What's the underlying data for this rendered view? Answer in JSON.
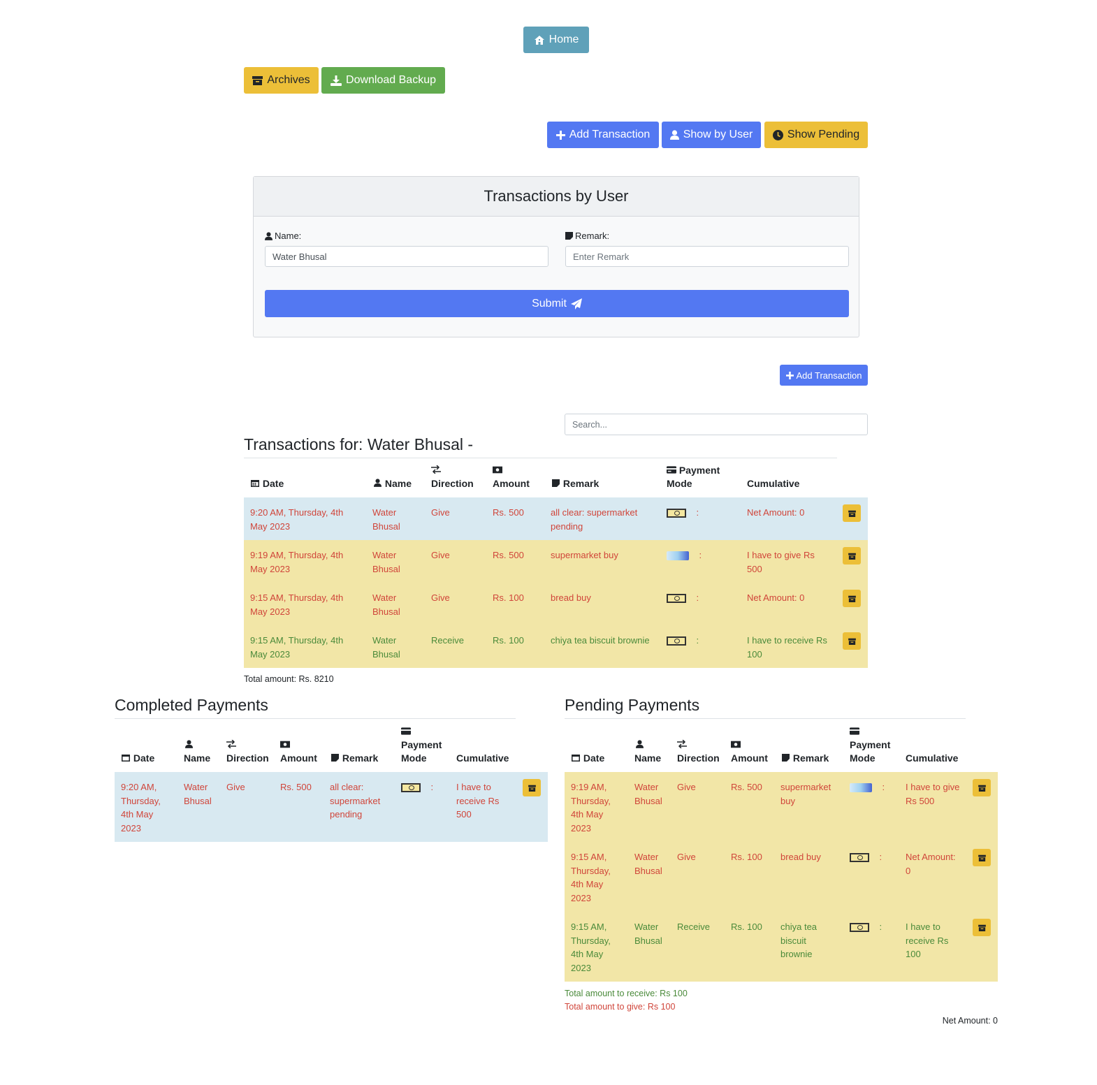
{
  "nav": {
    "home": "Home",
    "archives": "Archives",
    "download_backup": "Download Backup"
  },
  "toolbar": {
    "add_transaction": "Add Transaction",
    "show_by_user": "Show by User",
    "show_pending": "Show Pending"
  },
  "form": {
    "title": "Transactions by User",
    "name_label": "Name:",
    "name_value": "Water Bhusal",
    "remark_label": "Remark:",
    "remark_placeholder": "Enter Remark",
    "submit": "Submit"
  },
  "add_transaction_small": "Add Transaction",
  "search_placeholder": "Search...",
  "main_table": {
    "title": "Transactions for: Water Bhusal -",
    "headers": {
      "date": "Date",
      "name": "Name",
      "direction": "Direction",
      "amount": "Amount",
      "remark": "Remark",
      "payment_mode": "Payment Mode",
      "cumulative": "Cumulative"
    },
    "rows": [
      {
        "date": "9:20 AM, Thursday, 4th May 2023",
        "name": "Water Bhusal",
        "direction": "Give",
        "amount": "Rs. 500",
        "remark": "all clear: supermarket pending",
        "mode_icon": "cash-icon",
        "mode_sep": ":",
        "cumulative": "Net Amount: 0"
      },
      {
        "date": "9:19 AM, Thursday, 4th May 2023",
        "name": "Water Bhusal",
        "direction": "Give",
        "amount": "Rs. 500",
        "remark": "supermarket buy",
        "mode_icon": "card-icon",
        "mode_sep": ":",
        "cumulative": "I have to give Rs 500"
      },
      {
        "date": "9:15 AM, Thursday, 4th May 2023",
        "name": "Water Bhusal",
        "direction": "Give",
        "amount": "Rs. 100",
        "remark": "bread buy",
        "mode_icon": "cash-icon",
        "mode_sep": ":",
        "cumulative": "Net Amount: 0"
      },
      {
        "date": "9:15 AM, Thursday, 4th May 2023",
        "name": "Water Bhusal",
        "direction": "Receive",
        "amount": "Rs. 100",
        "remark": "chiya tea biscuit brownie",
        "mode_icon": "cash-icon",
        "mode_sep": ":",
        "cumulative": "I have to receive Rs 100"
      }
    ],
    "total": "Total amount: Rs. 8210"
  },
  "completed": {
    "title": "Completed Payments",
    "rows": [
      {
        "date": "9:20 AM, Thursday, 4th May 2023",
        "name": "Water Bhusal",
        "direction": "Give",
        "amount": "Rs. 500",
        "remark": "all clear: supermarket pending",
        "mode_icon": "cash-icon",
        "mode_sep": ":",
        "cumulative": "I have to receive Rs 500"
      }
    ]
  },
  "pending": {
    "title": "Pending Payments",
    "rows": [
      {
        "date": "9:19 AM, Thursday, 4th May 2023",
        "name": "Water Bhusal",
        "direction": "Give",
        "amount": "Rs. 500",
        "remark": "supermarket buy",
        "mode_icon": "card-icon",
        "mode_sep": ":",
        "cumulative": "I have to give Rs 500"
      },
      {
        "date": "9:15 AM, Thursday, 4th May 2023",
        "name": "Water Bhusal",
        "direction": "Give",
        "amount": "Rs. 100",
        "remark": "bread buy",
        "mode_icon": "cash-icon",
        "mode_sep": ":",
        "cumulative": "Net Amount: 0"
      },
      {
        "date": "9:15 AM, Thursday, 4th May 2023",
        "name": "Water Bhusal",
        "direction": "Receive",
        "amount": "Rs. 100",
        "remark": "chiya tea biscuit brownie",
        "mode_icon": "cash-icon",
        "mode_sep": ":",
        "cumulative": "I have to receive Rs 100"
      }
    ],
    "total_receive": "Total amount to receive: Rs 100",
    "total_give": "Total amount to give: Rs 100",
    "net": "Net Amount: 0"
  },
  "colors": {
    "give": "#d0453a",
    "receive": "#4a8a3a",
    "primary": "#5378f2",
    "warning": "#ecbf38",
    "success": "#62ab4f",
    "info": "#5fa1b9"
  }
}
